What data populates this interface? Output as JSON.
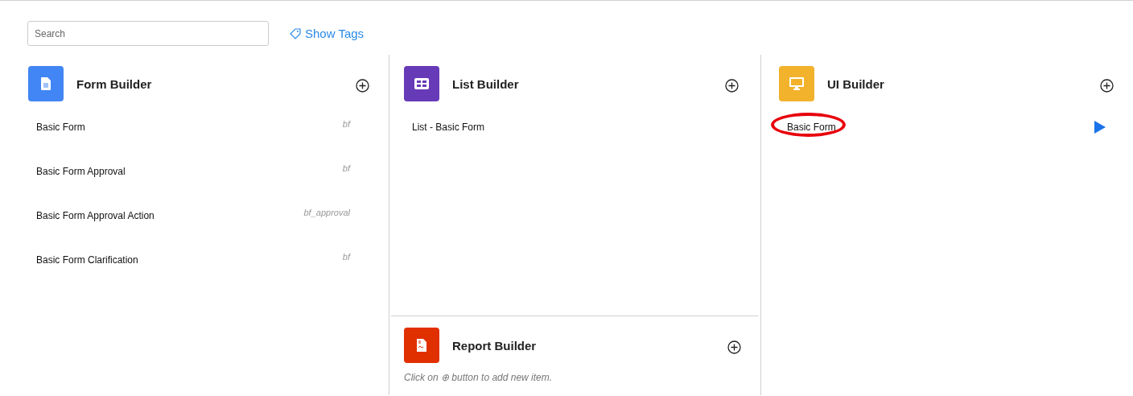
{
  "search": {
    "placeholder": "Search"
  },
  "show_tags": {
    "label": "Show Tags"
  },
  "columns": [
    {
      "sections": [
        {
          "kind": "form",
          "color": "#4285f4",
          "title": "Form Builder",
          "items": [
            {
              "label": "Basic Form",
              "tag": "bf"
            },
            {
              "label": "Basic Form Approval",
              "tag": "bf"
            },
            {
              "label": "Basic Form Approval Action",
              "tag": "bf_approval"
            },
            {
              "label": "Basic Form Clarification",
              "tag": "bf"
            }
          ]
        }
      ]
    },
    {
      "sections": [
        {
          "kind": "list",
          "color": "#673ab7",
          "title": "List Builder",
          "items": [
            {
              "label": "List - Basic Form"
            }
          ]
        },
        {
          "kind": "report",
          "color": "#e13000",
          "title": "Report Builder",
          "hint": "Click on ⊕ button to add new item."
        }
      ]
    },
    {
      "sections": [
        {
          "kind": "ui",
          "color": "#f2b22c",
          "title": "UI Builder",
          "items": [
            {
              "label": "Basic Form",
              "runnable": true,
              "circled": true
            }
          ]
        }
      ]
    }
  ]
}
